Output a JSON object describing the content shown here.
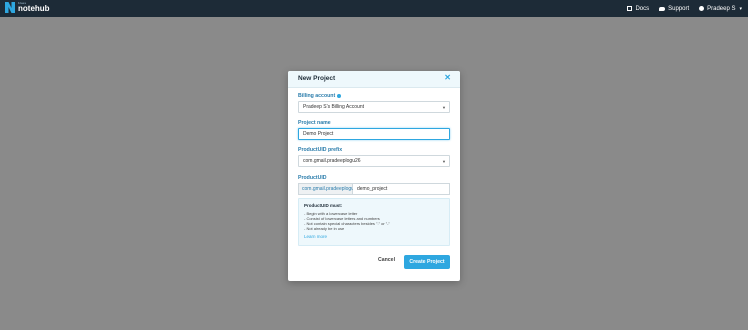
{
  "header": {
    "logo_small": "blues",
    "logo_big": "notehub",
    "nav": {
      "docs": "Docs",
      "support": "Support",
      "user": "Pradeep S"
    }
  },
  "modal": {
    "title": "New Project",
    "billing_account": {
      "label": "Billing account",
      "value": "Pradeep S's Billing Account"
    },
    "project_name": {
      "label": "Project name",
      "value": "Demo Project"
    },
    "productuid_prefix": {
      "label": "ProductUID prefix",
      "value": "com.gmail.pradeeplogu26"
    },
    "productuid": {
      "label": "ProductUID",
      "prefix": "com.gmail.pradeeplogu26:",
      "value": "demo_project"
    },
    "rules": {
      "title": "ProductUID must:",
      "items": [
        "- Begin with a lowercase letter",
        "- Consist of lowercase letters and numbers",
        "- Not contain special characters besides \".\" or \"-\"",
        "- Not already be in use"
      ],
      "learn_more": "Learn more"
    },
    "cancel_label": "Cancel",
    "create_label": "Create Project"
  },
  "colors": {
    "topbar": "#1d2b37",
    "accent": "#2ea7e0",
    "overlay": "#8a8a8a"
  }
}
